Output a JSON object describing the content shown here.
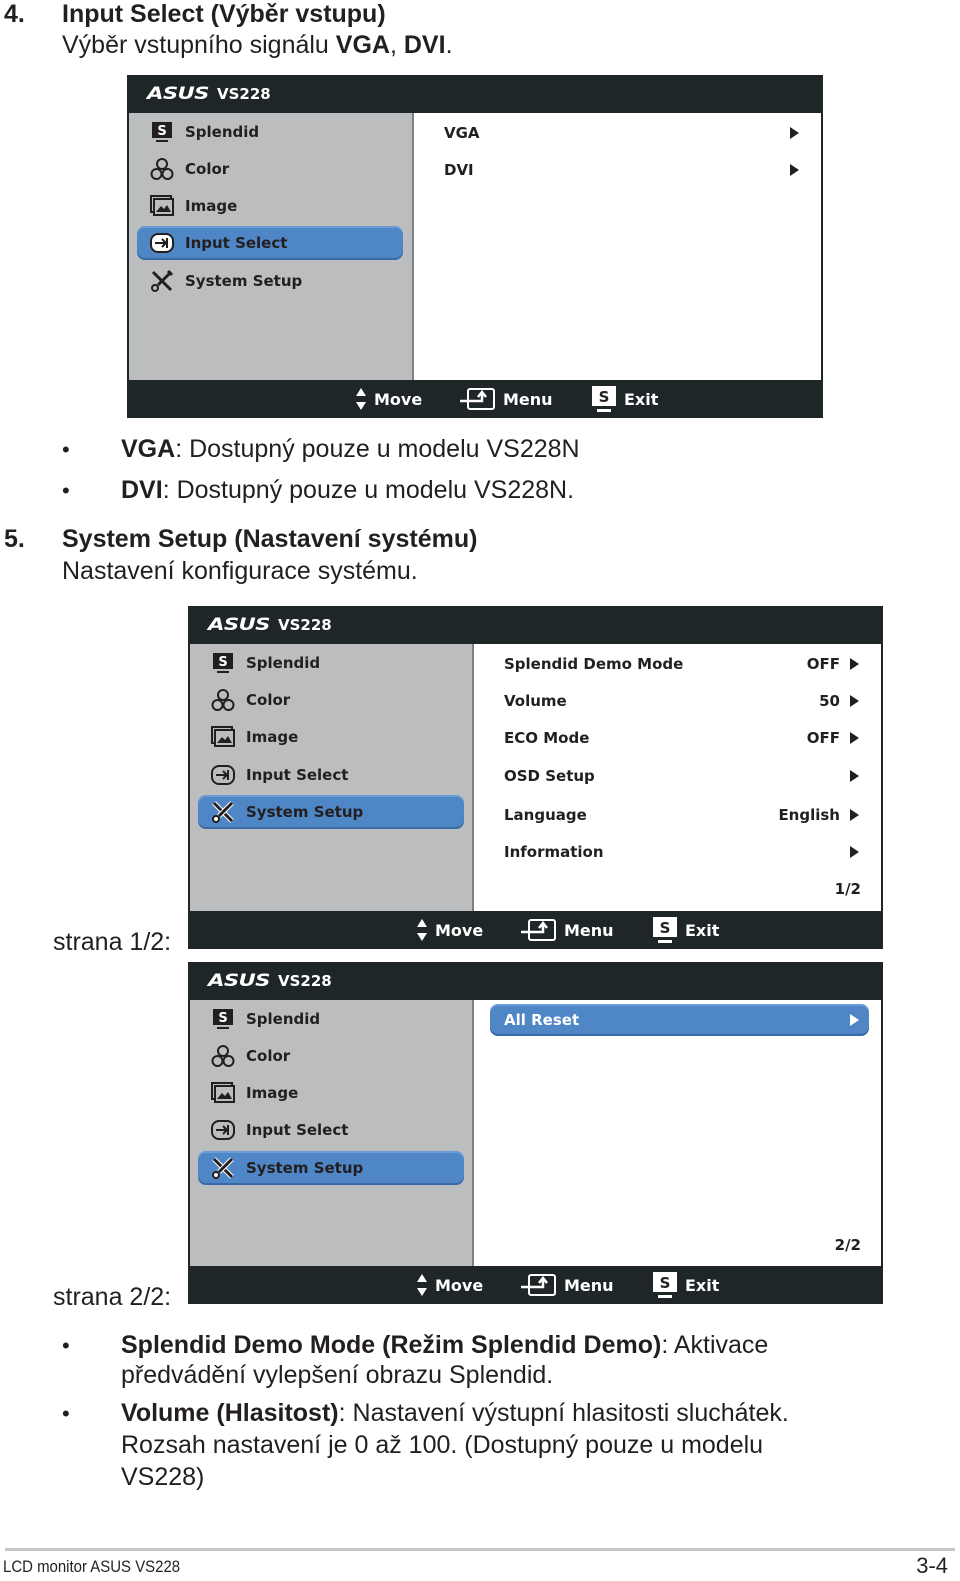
{
  "section4": {
    "number": "4.",
    "title": "Input Select (Výběr vstupu)",
    "desc_prefix": "Výběr vstupního signálu ",
    "desc_bold1": "VGA",
    "desc_sep": ", ",
    "desc_bold2": "DVI",
    "desc_suffix": ".",
    "bullets": [
      {
        "bold": "VGA",
        "text": ": Dostupný pouze u modelu VS228N"
      },
      {
        "bold": "DVI",
        "text": ": Dostupný pouze u modelu VS228N."
      }
    ]
  },
  "section5": {
    "number": "5.",
    "title": "System Setup (Nastavení systému)",
    "desc": "Nastavení konfigurace systému.",
    "page1_label": "strana 1/2:",
    "page2_label": "strana 2/2:",
    "bullets": [
      {
        "bold": "Splendid Demo Mode (Režim Splendid Demo)",
        "text": ": Aktivace",
        "line2": "předvádění vylepšení obrazu Splendid."
      },
      {
        "bold": "Volume (Hlasitost)",
        "text": ": Nastavení výstupní hlasitosti sluchátek.",
        "line2": "Rozsah nastavení je 0 až 100. (Dostupný pouze u modelu",
        "line3": "VS228)"
      }
    ]
  },
  "osd_common": {
    "brand": "ASUS",
    "model": "VS228",
    "sidebar": [
      {
        "label": "Splendid",
        "icon": "splendid-icon"
      },
      {
        "label": "Color",
        "icon": "color-icon"
      },
      {
        "label": "Image",
        "icon": "image-icon"
      },
      {
        "label": "Input Select",
        "icon": "input-select-icon"
      },
      {
        "label": "System Setup",
        "icon": "system-setup-icon"
      }
    ],
    "footer": {
      "move": "Move",
      "menu": "Menu",
      "exit": "Exit"
    }
  },
  "osd_input": {
    "selected": "Input Select",
    "items": [
      {
        "label": "VGA"
      },
      {
        "label": "DVI"
      }
    ]
  },
  "osd_system_p1": {
    "selected": "System Setup",
    "items": [
      {
        "label": "Splendid Demo Mode",
        "value": "OFF"
      },
      {
        "label": "Volume",
        "value": "50"
      },
      {
        "label": "ECO Mode",
        "value": "OFF"
      },
      {
        "label": "OSD Setup",
        "value": ""
      },
      {
        "label": "Language",
        "value": "English"
      },
      {
        "label": "Information",
        "value": ""
      }
    ],
    "page": "1/2"
  },
  "osd_system_p2": {
    "selected": "System Setup",
    "items": [
      {
        "label": "All Reset"
      }
    ],
    "page": "2/2"
  },
  "page_footer": {
    "left": "LCD monitor ASUS VS228",
    "right": "3-4"
  }
}
